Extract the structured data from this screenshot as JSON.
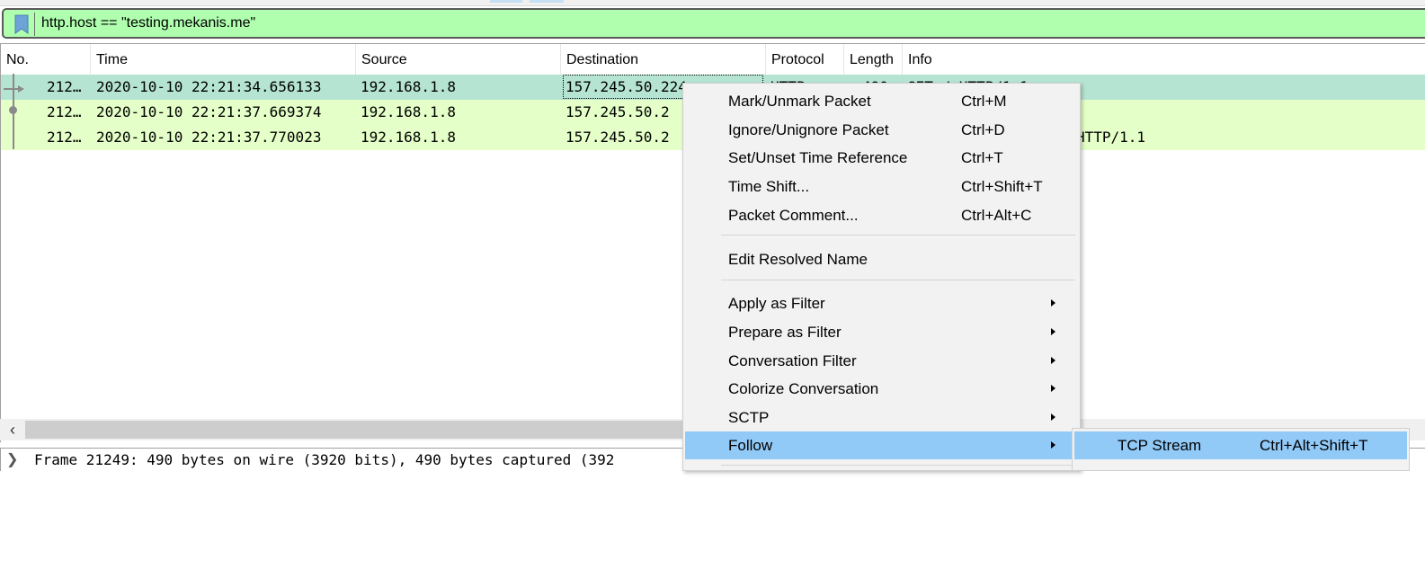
{
  "filter": {
    "text": "http.host == \"testing.mekanis.me\""
  },
  "columns": [
    "No.",
    "Time",
    "Source",
    "Destination",
    "Protocol",
    "Length",
    "Info"
  ],
  "packets": [
    {
      "no": "212…",
      "time": "2020-10-10 22:21:34.656133",
      "source": "192.168.1.8",
      "destination": "157.245.50.224",
      "protocol": "HTTP",
      "length": "490",
      "info": "GET / HTTP/1.1"
    },
    {
      "no": "212…",
      "time": "2020-10-10 22:21:37.669374",
      "source": "192.168.1.8",
      "destination": "157.245.50.2",
      "protocol": "",
      "length": "",
      "info": ""
    },
    {
      "no": "212…",
      "time": "2020-10-10 22:21:37.770023",
      "source": "192.168.1.8",
      "destination": "157.245.50.2",
      "protocol": "",
      "length": "",
      "info": "HTTP/1.1"
    }
  ],
  "details": {
    "frame_text": "Frame 21249: 490 bytes on wire (3920 bits), 490 bytes captured (392"
  },
  "context_menu": {
    "items": [
      {
        "label": "Mark/Unmark Packet",
        "shortcut": "Ctrl+M"
      },
      {
        "label": "Ignore/Unignore Packet",
        "shortcut": "Ctrl+D"
      },
      {
        "label": "Set/Unset Time Reference",
        "shortcut": "Ctrl+T"
      },
      {
        "label": "Time Shift...",
        "shortcut": "Ctrl+Shift+T"
      },
      {
        "label": "Packet Comment...",
        "shortcut": "Ctrl+Alt+C"
      },
      {
        "label": "Edit Resolved Name",
        "shortcut": ""
      },
      {
        "label": "Apply as Filter",
        "shortcut": ""
      },
      {
        "label": "Prepare as Filter",
        "shortcut": ""
      },
      {
        "label": "Conversation Filter",
        "shortcut": ""
      },
      {
        "label": "Colorize Conversation",
        "shortcut": ""
      },
      {
        "label": "SCTP",
        "shortcut": ""
      },
      {
        "label": "Follow",
        "shortcut": ""
      }
    ]
  },
  "submenu": {
    "items": [
      {
        "label": "TCP Stream",
        "shortcut": "Ctrl+Alt+Shift+T"
      }
    ]
  },
  "colors": {
    "filter_bg": "#afffaf",
    "selected_row": "#b5e5d2",
    "http_row": "#e4ffc7",
    "menu_highlight": "#91c9f7"
  }
}
